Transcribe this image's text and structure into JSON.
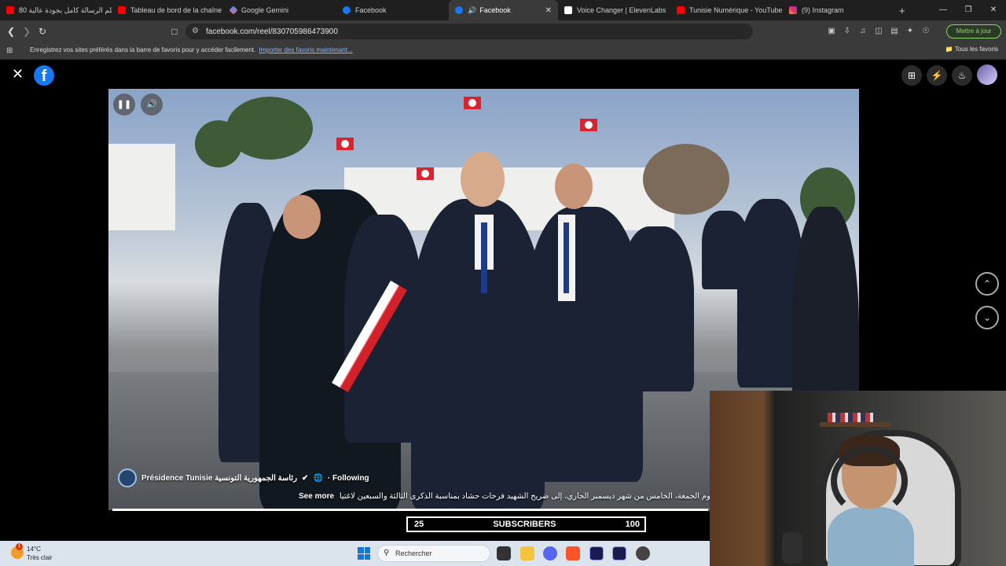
{
  "browser": {
    "tabs": [
      {
        "label": "فيلم الرسالة كامل بجودة عالية 80",
        "icon": "youtube-icon",
        "color": "#ff0000"
      },
      {
        "label": "Tableau de bord de la chaîne -",
        "icon": "youtube-studio-icon",
        "color": "#ff0000"
      },
      {
        "label": "Google Gemini",
        "icon": "gemini-icon",
        "color": "#8ab4f8"
      },
      {
        "label": "Facebook",
        "icon": "facebook-icon",
        "color": "#1877f2"
      },
      {
        "label": "Facebook",
        "icon": "facebook-icon",
        "color": "#1877f2",
        "active": true,
        "audio": "speaker-icon"
      },
      {
        "label": "Voice Changer | ElevenLabs",
        "icon": "elevenlabs-icon",
        "color": "#ffffff"
      },
      {
        "label": "Tunisie Numérique - YouTube",
        "icon": "youtube-icon",
        "color": "#ff0000"
      },
      {
        "label": "(9) Instagram",
        "icon": "instagram-icon",
        "color": "#e1306c"
      }
    ],
    "new_tab": "+",
    "url": "facebook.com/reel/830705986473900",
    "update_button": "Mettre à jour",
    "bookmarks_hint": "Enregistrez vos sites préférés dans la barre de favoris pour y accéder facilement.",
    "bookmarks_import": "Importer des favoris maintenant...",
    "all_bookmarks": "Tous les favoris"
  },
  "facebook": {
    "logo": "f",
    "channel_name": "Présidence Tunisie رئاسة الجمهورية التونسية",
    "following": "· Following",
    "caption_see_more": "See more",
    "caption": "اليوم الجمعة، الخامس من شهر ديسمبر الجاري، إلى ضريح الشهيد فرحات حشاد بمناسبة الذكرى الثالثة والسبعين لاغتيا...",
    "progress": 0.997
  },
  "overlay": {
    "subs_left": "25",
    "subs_label": "SUBSCRIBERS",
    "subs_right": "100"
  },
  "taskbar": {
    "temperature": "14°C",
    "weather": "Très clair",
    "weather_badge": "1",
    "search_placeholder": "Rechercher"
  }
}
